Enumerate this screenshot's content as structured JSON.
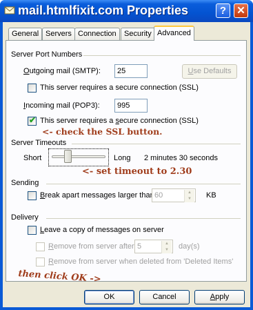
{
  "window": {
    "title": "mail.htmlfixit.com Properties",
    "help_glyph": "?",
    "close_glyph": "✕"
  },
  "tabs": [
    {
      "label": "General",
      "active": false
    },
    {
      "label": "Servers",
      "active": false
    },
    {
      "label": "Connection",
      "active": false
    },
    {
      "label": "Security",
      "active": false
    },
    {
      "label": "Advanced",
      "active": true
    }
  ],
  "server_ports": {
    "title": "Server Port Numbers",
    "outgoing_label_u": "O",
    "outgoing_label_rest": "utgoing mail (SMTP):",
    "outgoing_value": "25",
    "use_defaults_u": "U",
    "use_defaults_rest": "se Defaults",
    "outgoing_ssl_label": "This server requires a secure connection (SSL)",
    "outgoing_ssl_checked": false,
    "incoming_label_u": "I",
    "incoming_label_rest": "ncoming mail (POP3):",
    "incoming_value": "995",
    "incoming_ssl_label_pre": "This server requires a ",
    "incoming_ssl_label_u": "s",
    "incoming_ssl_label_post": "ecure connection (SSL)",
    "incoming_ssl_checked": true
  },
  "timeouts": {
    "title": "Server Timeouts",
    "short_label": "Short",
    "long_label": "Long",
    "value_text": "2 minutes 30 seconds",
    "slider_fraction": 0.27
  },
  "sending": {
    "title": "Sending",
    "break_label_u": "B",
    "break_label_rest": "reak apart messages larger than",
    "break_checked": false,
    "break_value": "60",
    "break_unit": "KB"
  },
  "delivery": {
    "title": "Delivery",
    "leave_copy_u": "L",
    "leave_copy_rest": "eave a copy of messages on server",
    "leave_copy_checked": false,
    "remove_after_u": "R",
    "remove_after_rest": "emove from server after",
    "remove_after_value": "5",
    "remove_after_unit": "day(s)",
    "remove_deleted_u": "R",
    "remove_deleted_rest": "emove from server when deleted from 'Deleted Items'"
  },
  "annotations": {
    "ssl_note": "<- check the SSL button.",
    "timeout_note": "<- set timeout to 2.30",
    "ok_note": "then click OK ->"
  },
  "buttons": {
    "ok": "OK",
    "cancel": "Cancel",
    "apply_u": "A",
    "apply_rest": "pply"
  },
  "colors": {
    "titlebar": "#0a5ad6",
    "annotation": "#a03d1c",
    "checkmark": "#21a121",
    "active_tab_accent": "#ffc83c"
  },
  "icons": {
    "title_icon": "envelope-icon",
    "checkmark": "checkmark-icon"
  }
}
